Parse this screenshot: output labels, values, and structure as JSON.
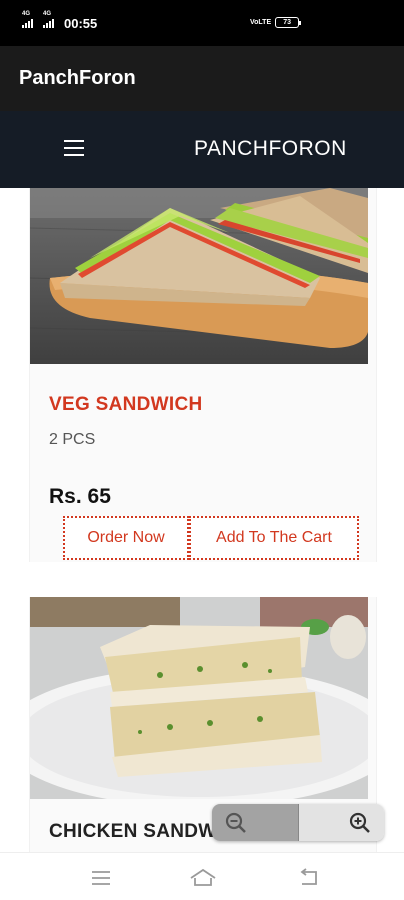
{
  "status_bar": {
    "time": "00:55",
    "signal_1_label": "4G",
    "signal_2_label": "4G",
    "network_label": "VoLTE",
    "battery_level": "73"
  },
  "app_bar": {
    "title": "PanchForon"
  },
  "site_header": {
    "brand": "PANCHFORON",
    "menu_icon": "hamburger-menu-icon"
  },
  "products": [
    {
      "name": "VEG SANDWICH",
      "description": "2 PCS",
      "price": "Rs. 65",
      "order_label": "Order Now",
      "cart_label": "Add To The Cart",
      "name_color": "#d2381f"
    },
    {
      "name": "CHICKEN SANDWICH",
      "name_color": "#222222"
    }
  ],
  "zoom_control": {
    "zoom_out_icon": "zoom-out-icon",
    "zoom_in_icon": "zoom-in-icon"
  },
  "nav_bar": {
    "icons": [
      "menu-icon",
      "home-icon",
      "back-icon"
    ]
  },
  "colors": {
    "accent": "#d2381f",
    "header_bg": "#151c26",
    "app_bar_bg": "#1b1b1b"
  }
}
